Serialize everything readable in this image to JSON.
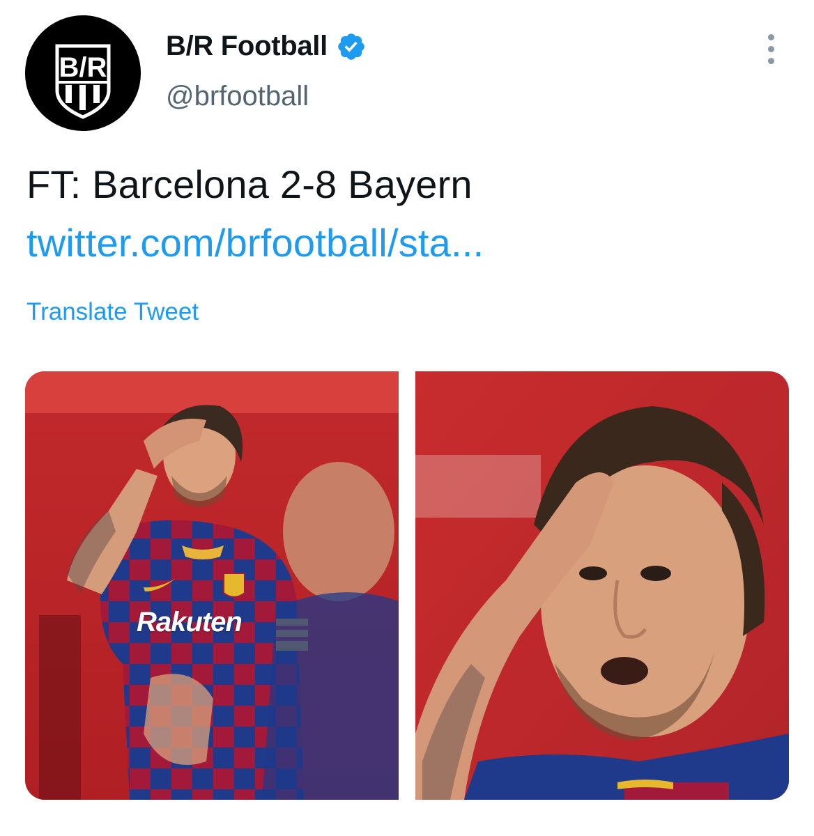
{
  "tweet": {
    "author": {
      "display_name": "B/R Football",
      "handle": "@brfootball",
      "avatar_text": "B/R",
      "verified_icon": "verified-badge-icon"
    },
    "more_icon": "more-vertical-icon",
    "text": "FT: Barcelona 2-8 Bayern",
    "link": "twitter.com/brfootball/sta...",
    "translate_label": "Translate Tweet",
    "media": {
      "count": 2,
      "photo_1": {
        "jersey_text": "Rakuten"
      }
    }
  },
  "colors": {
    "accent": "#1d9bf0",
    "verified": "#1d9bf0",
    "text_primary": "#0f1419",
    "text_secondary": "#536471",
    "stadium_red": "#c8282a",
    "barca_blue": "#1f3a8a",
    "barca_garnet": "#a3193a"
  }
}
